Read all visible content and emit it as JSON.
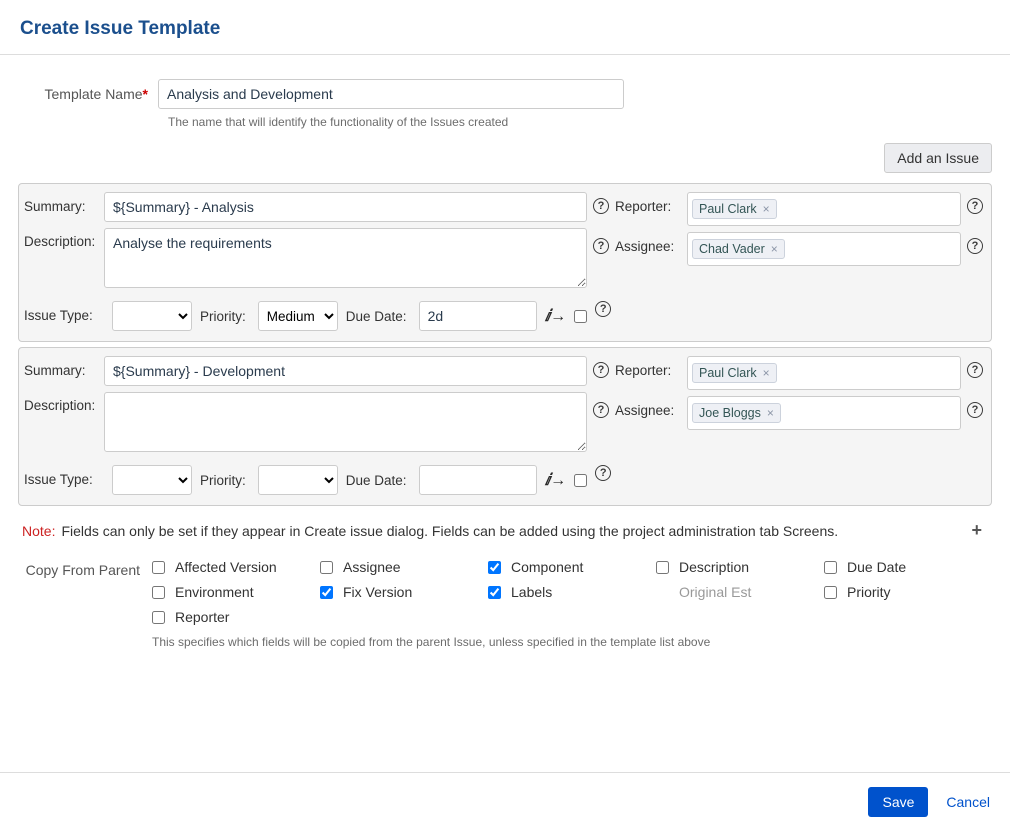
{
  "title": "Create Issue Template",
  "templateNameLabel": "Template Name",
  "templateNameValue": "Analysis and Development",
  "templateNameHelp": "The name that will identify the functionality of the Issues created",
  "addIssue": "Add an Issue",
  "labels": {
    "summary": "Summary:",
    "description": "Description:",
    "issueType": "Issue Type:",
    "priority": "Priority:",
    "dueDate": "Due Date:",
    "reporter": "Reporter:",
    "assignee": "Assignee:"
  },
  "issues": [
    {
      "summary": "${Summary} - Analysis",
      "description": "Analyse the requirements",
      "issueType": "",
      "priority": "Medium",
      "dueDate": "2d",
      "reporter": "Paul Clark",
      "assignee": "Chad Vader"
    },
    {
      "summary": "${Summary} - Development",
      "description": "",
      "issueType": "",
      "priority": "",
      "dueDate": "",
      "reporter": "Paul Clark",
      "assignee": "Joe Bloggs"
    }
  ],
  "noteLabel": "Note:",
  "noteText": "Fields can only be set if they appear in Create issue dialog. Fields can be added using the project administration tab Screens.",
  "copy": {
    "label": "Copy From Parent",
    "items": [
      {
        "label": "Affected Version",
        "checked": false
      },
      {
        "label": "Assignee",
        "checked": false
      },
      {
        "label": "Component",
        "checked": true
      },
      {
        "label": "Description",
        "checked": false
      },
      {
        "label": "Due Date",
        "checked": false
      },
      {
        "label": "Environment",
        "checked": false
      },
      {
        "label": "Fix Version",
        "checked": true
      },
      {
        "label": "Labels",
        "checked": true
      },
      {
        "label": "Original Est",
        "checked": false,
        "blank": true
      },
      {
        "label": "Priority",
        "checked": false
      },
      {
        "label": "Reporter",
        "checked": false
      }
    ],
    "help": "This specifies which fields will be copied from the parent Issue, unless specified in the template list above"
  },
  "footer": {
    "save": "Save",
    "cancel": "Cancel"
  }
}
